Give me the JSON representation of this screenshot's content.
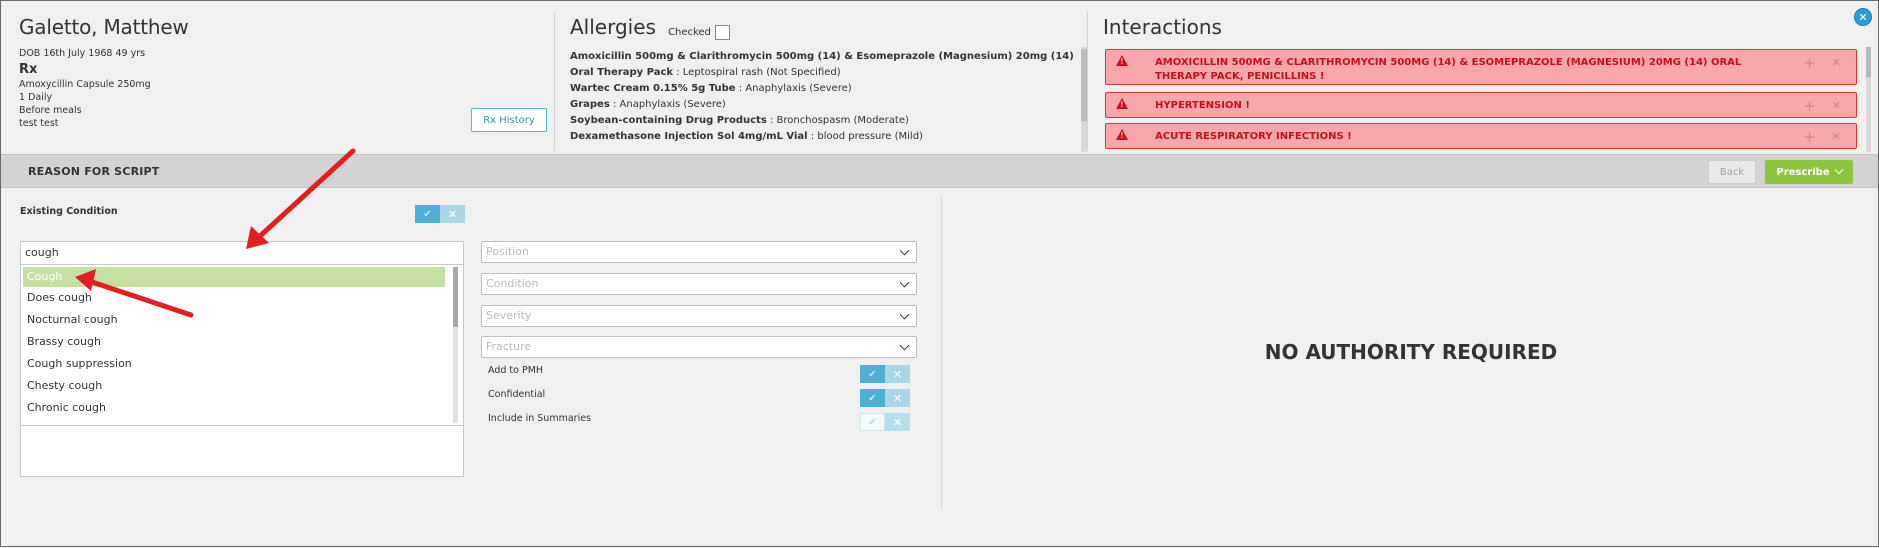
{
  "patient": {
    "name": "Galetto, Matthew",
    "dob": "DOB 16th July 1968 49 yrs",
    "rx_label": "Rx",
    "rx_lines": [
      "Amoxycillin Capsule 250mg",
      "1 Daily",
      "Before meals",
      "test test"
    ],
    "rx_history_button": "Rx History"
  },
  "allergies": {
    "title": "Allergies",
    "checked_label": "Checked",
    "items": [
      {
        "name": "Amoxicillin 500mg & Clarithromycin 500mg (14) & Esomeprazole (Magnesium) 20mg (14) Oral Therapy Pack",
        "reaction": "Leptospiral rash (Not Specified)"
      },
      {
        "name": "Wartec Cream 0.15% 5g Tube",
        "reaction": "Anaphylaxis (Severe)"
      },
      {
        "name": "Grapes",
        "reaction": "Anaphylaxis (Severe)"
      },
      {
        "name": "Soybean-containing Drug Products",
        "reaction": "Bronchospasm (Moderate)"
      },
      {
        "name": "Dexamethasone Injection Sol 4mg/mL Vial",
        "reaction": "blood pressure (Mild)"
      }
    ]
  },
  "interactions": {
    "title": "Interactions",
    "items": [
      "AMOXICILLIN 500MG & CLARITHROMYCIN 500MG (14) & ESOMEPRAZOLE (MAGNESIUM) 20MG (14) ORAL THERAPY PACK, PENICILLINS !",
      "HYPERTENSION !",
      "ACUTE RESPIRATORY INFECTIONS !"
    ]
  },
  "bar": {
    "title": "REASON FOR SCRIPT",
    "back_button": "Back",
    "prescribe_button": "Prescribe"
  },
  "condition": {
    "label": "Existing Condition",
    "search_value": "cough",
    "suggestions": [
      "Cough",
      "Does cough",
      "Nocturnal cough",
      "Brassy cough",
      "Cough suppression",
      "Chesty cough",
      "Chronic cough"
    ]
  },
  "fields": {
    "position_placeholder": "Position",
    "condition_placeholder": "Condition",
    "severity_placeholder": "Severity",
    "fracture_placeholder": "Fracture"
  },
  "options": {
    "add_to_pmh": "Add to PMH",
    "confidential": "Confidential",
    "include_in_summaries": "Include in Summaries"
  },
  "authority": {
    "message": "NO AUTHORITY REQUIRED"
  },
  "colors": {
    "accent": "#4cafd4",
    "prescribe": "#8cc63f",
    "alert_bg": "#f7a6a9",
    "alert_text": "#c0131c",
    "selected_row": "#c6e0a2",
    "annotation_arrow": "#e02020"
  }
}
